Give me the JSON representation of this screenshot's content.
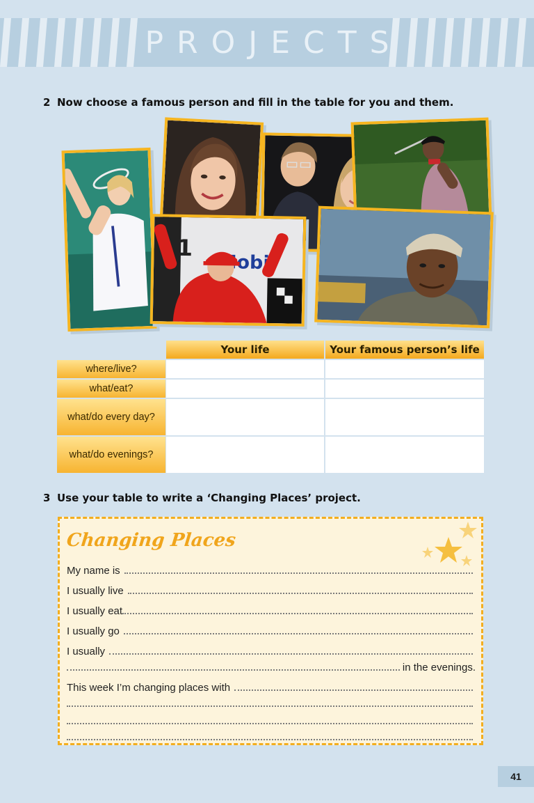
{
  "banner": {
    "title": "PROJECTS"
  },
  "task2": {
    "number": "2",
    "text": "Now choose a famous person and fill in the table for you and them."
  },
  "photos": [
    {
      "name": "tennis-player"
    },
    {
      "name": "actress-smiling"
    },
    {
      "name": "celebrity-couple"
    },
    {
      "name": "golfer"
    },
    {
      "name": "racing-driver"
    },
    {
      "name": "actor-in-cap"
    }
  ],
  "photo_texts": {
    "racing_sign": "Mobil",
    "racing_one": "1"
  },
  "table": {
    "headers": [
      "Your life",
      "Your famous person’s life"
    ],
    "rows": [
      {
        "label": "where/live?"
      },
      {
        "label": "what/eat?"
      },
      {
        "label": "what/do every day?"
      },
      {
        "label": "what/do evenings?"
      }
    ]
  },
  "task3": {
    "number": "3",
    "text": "Use your table to write a ‘Changing Places’ project."
  },
  "project": {
    "title": "Changing Places",
    "lines": [
      "My name is",
      "I usually live",
      "I usually eat",
      "I usually go",
      "I usually",
      "in the evenings.",
      "This week I’m changing places with"
    ]
  },
  "colors": {
    "accent": "#f3ae1f",
    "background": "#d3e2ee",
    "banner": "#b7cfe0"
  },
  "page": {
    "number": "41"
  }
}
